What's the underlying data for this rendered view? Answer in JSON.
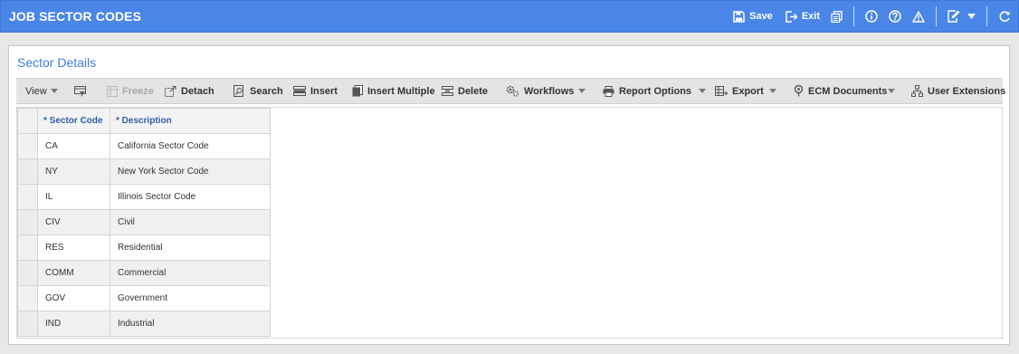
{
  "window": {
    "title": "JOB SECTOR CODES",
    "save_label": "Save",
    "exit_label": "Exit"
  },
  "panel": {
    "title": "Sector Details"
  },
  "toolbar": {
    "view": "View",
    "freeze": "Freeze",
    "detach": "Detach",
    "search": "Search",
    "insert": "Insert",
    "insert_multiple": "Insert Multiple",
    "delete": "Delete",
    "workflows": "Workflows",
    "report_options": "Report Options",
    "export": "Export",
    "ecm_documents": "ECM Documents",
    "user_extensions": "User Extensions"
  },
  "grid": {
    "columns": [
      "* Sector Code",
      "* Description"
    ],
    "rows": [
      {
        "code": "CA",
        "description": "California Sector Code"
      },
      {
        "code": "NY",
        "description": "New York Sector Code"
      },
      {
        "code": "IL",
        "description": "Illinois Sector Code"
      },
      {
        "code": "CIV",
        "description": "Civil"
      },
      {
        "code": "RES",
        "description": "Residential"
      },
      {
        "code": "COMM",
        "description": "Commercial"
      },
      {
        "code": "GOV",
        "description": "Government"
      },
      {
        "code": "IND",
        "description": "Industrial"
      }
    ]
  },
  "colors": {
    "titlebar": "#4a86e8",
    "panel_title": "#3d7fd6",
    "header_text": "#2f5ea8"
  }
}
